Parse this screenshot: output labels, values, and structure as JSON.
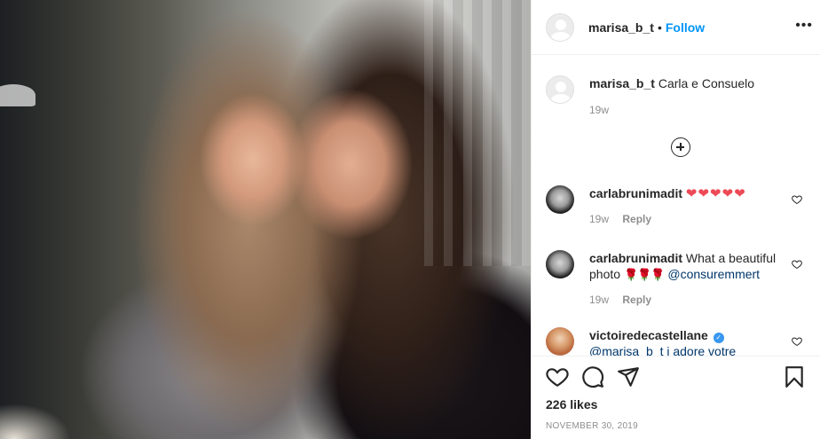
{
  "post": {
    "image_alt": "Two women smiling together"
  },
  "header": {
    "username": "marisa_b_t",
    "separator": "•",
    "follow_label": "Follow",
    "more_icon": "more-icon"
  },
  "caption": {
    "username": "marisa_b_t",
    "text": "Carla e Consuelo",
    "time": "19w"
  },
  "comments": [
    {
      "username": "carlabrunimadit",
      "text": "❤❤❤❤❤",
      "time": "19w",
      "reply_label": "Reply"
    },
    {
      "username": "carlabrunimadit",
      "text": "What a beautiful photo",
      "emoji": "🌹🌹🌹",
      "mention": "@consuremmert",
      "time": "19w",
      "reply_label": "Reply"
    },
    {
      "username": "victoiredecastellane",
      "verified": "✓",
      "text": "@marisa_b_t j adore votre"
    }
  ],
  "actions": {
    "likes": "226 likes",
    "date": "NOVEMBER 30, 2019"
  },
  "colors": {
    "accent": "#0095f6",
    "text": "#262626",
    "muted": "#8e8e8e",
    "heart": "#ed4956"
  }
}
